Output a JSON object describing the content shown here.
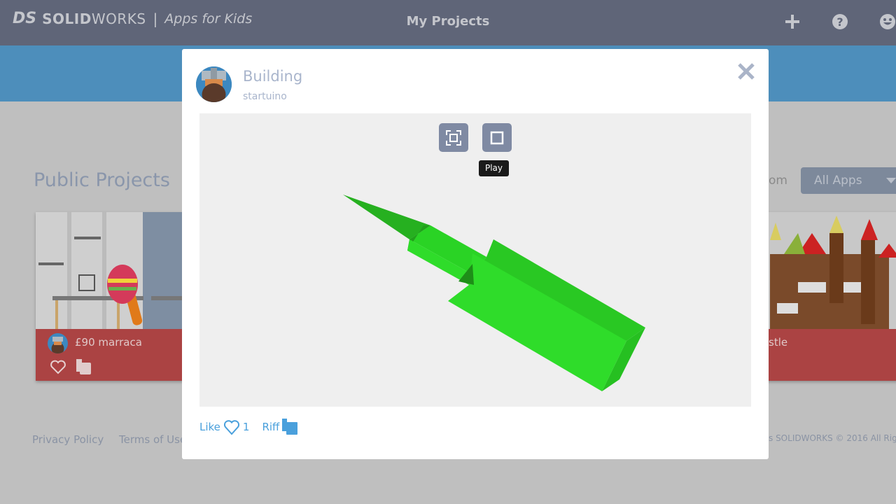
{
  "header": {
    "logo_ds": "DS",
    "logo_solid": "SOLID",
    "logo_works": "WORKS",
    "logo_sep": "|",
    "logo_apps": "Apps for Kids",
    "title": "My Projects",
    "icons": [
      "plus-icon",
      "help-icon",
      "smiley-icon"
    ]
  },
  "main": {
    "title": "Public Projects",
    "sort_fragment": "om",
    "filter": {
      "selected": "All Apps"
    },
    "cards": [
      {
        "name": "£90 marraca"
      },
      {
        "name_fragment": "stle"
      }
    ]
  },
  "footer": {
    "privacy": "Privacy Policy",
    "terms": "Terms of Use",
    "copyright_fragment": "s SOLIDWORKS © 2016 All Right"
  },
  "modal": {
    "title": "Building",
    "user": "startuino",
    "tooltip": "Play",
    "like_label": "Like",
    "like_count": "1",
    "riff_label": "Riff",
    "model_color": "#2fdc2a"
  },
  "colors": {
    "header": "#5f6578",
    "band": "#4d8ebb",
    "card": "#ab4343",
    "accent": "#4aa0dc"
  }
}
